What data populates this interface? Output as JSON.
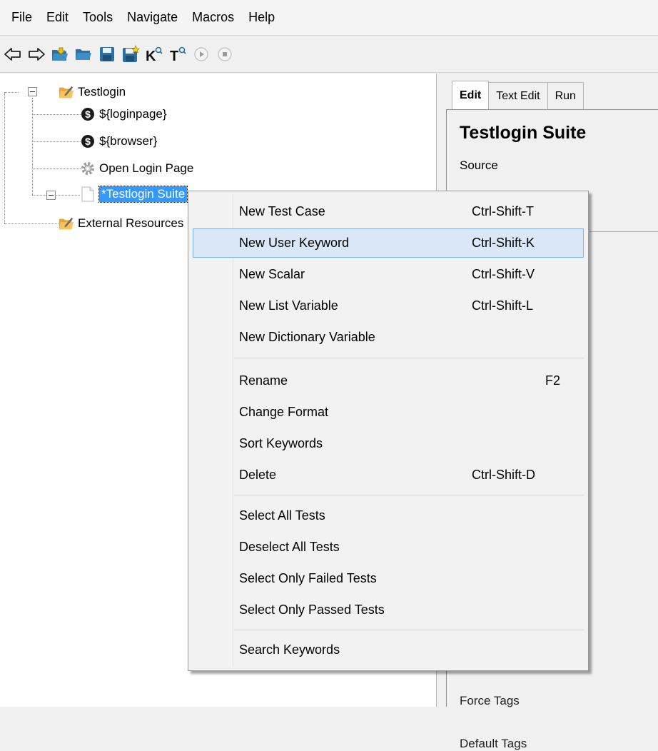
{
  "menubar": {
    "items": [
      "File",
      "Edit",
      "Tools",
      "Navigate",
      "Macros",
      "Help"
    ]
  },
  "toolbar": {
    "icons": [
      "back-arrow-icon",
      "forward-arrow-icon",
      "open-suite-icon",
      "open-directory-icon",
      "save-icon",
      "save-all-icon",
      "search-keywords-icon",
      "search-tests-icon",
      "run-icon",
      "stop-icon"
    ]
  },
  "tree": {
    "root_label": "Testlogin",
    "var1_label": "${loginpage}",
    "var2_label": "${browser}",
    "keyword_label": "Open Login Page",
    "suite_label": "*Testlogin Suite",
    "external_label": "External Resources"
  },
  "right_panel": {
    "tabs": [
      "Edit",
      "Text Edit",
      "Run"
    ],
    "title": "Testlogin Suite",
    "source_label": "Source",
    "partial_force_tags": "Force Tags",
    "partial_default_tags": "Default Tags"
  },
  "context_menu": {
    "items": [
      {
        "label": "New Test Case",
        "shortcut": "Ctrl-Shift-T"
      },
      {
        "label": "New User Keyword",
        "shortcut": "Ctrl-Shift-K"
      },
      {
        "label": "New Scalar",
        "shortcut": "Ctrl-Shift-V"
      },
      {
        "label": "New List Variable",
        "shortcut": "Ctrl-Shift-L"
      },
      {
        "label": "New Dictionary Variable",
        "shortcut": ""
      },
      {
        "label": "Rename",
        "shortcut": "F2"
      },
      {
        "label": "Change Format",
        "shortcut": ""
      },
      {
        "label": "Sort Keywords",
        "shortcut": ""
      },
      {
        "label": "Delete",
        "shortcut": "Ctrl-Shift-D"
      },
      {
        "label": "Select All Tests",
        "shortcut": ""
      },
      {
        "label": "Deselect All Tests",
        "shortcut": ""
      },
      {
        "label": "Select Only Failed Tests",
        "shortcut": ""
      },
      {
        "label": "Select Only Passed Tests",
        "shortcut": ""
      },
      {
        "label": "Search Keywords",
        "shortcut": ""
      }
    ],
    "highlighted_index": 1
  },
  "colors": {
    "selection": "#3399ff",
    "menu_highlight": "#d9e7f6",
    "menu_highlight_border": "#7eb4ea"
  }
}
